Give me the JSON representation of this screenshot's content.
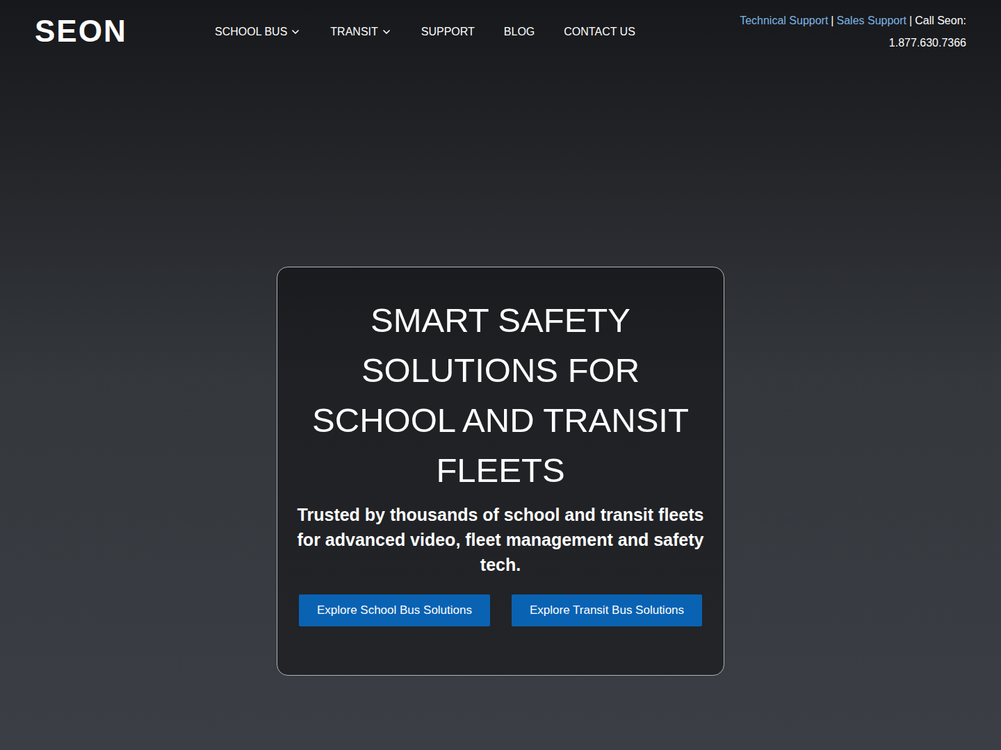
{
  "header": {
    "logo": "SEON",
    "nav": [
      {
        "label": "SCHOOL BUS",
        "dropdown": true
      },
      {
        "label": "TRANSIT",
        "dropdown": true
      },
      {
        "label": "SUPPORT",
        "dropdown": false
      },
      {
        "label": "BLOG",
        "dropdown": false
      },
      {
        "label": "CONTACT US",
        "dropdown": false
      }
    ],
    "contact": {
      "links": [
        "Technical Support",
        "Sales Support"
      ],
      "separator": "|",
      "call_label": "Call Seon:",
      "phone": "1.877.630.7366"
    }
  },
  "hero": {
    "heading": "SMART SAFETY SOLUTIONS FOR SCHOOL AND TRANSIT FLEETS",
    "subheading": "Trusted by thousands of school and transit fleets for advanced video, fleet management and safety tech.",
    "buttons": [
      "Explore School Bus Solutions",
      "Explore Transit Bus Solutions"
    ]
  }
}
